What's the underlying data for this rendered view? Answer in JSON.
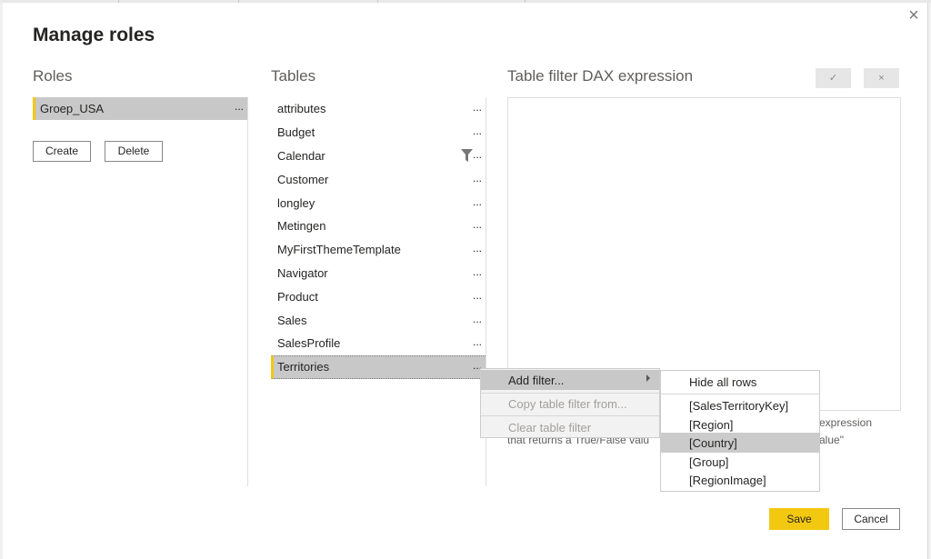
{
  "dialog": {
    "title": "Manage roles",
    "close_glyph": "×"
  },
  "roles": {
    "header": "Roles",
    "items": [
      {
        "label": "Groep_USA",
        "more": "..."
      }
    ],
    "create_label": "Create",
    "delete_label": "Delete"
  },
  "tables": {
    "header": "Tables",
    "items": [
      {
        "label": "attributes",
        "more": "..."
      },
      {
        "label": "Budget",
        "more": "..."
      },
      {
        "label": "Calendar",
        "more": "...",
        "icon": "filter-icon"
      },
      {
        "label": "Customer",
        "more": "..."
      },
      {
        "label": "longley",
        "more": "..."
      },
      {
        "label": "Metingen",
        "more": "..."
      },
      {
        "label": "MyFirstThemeTemplate",
        "more": "..."
      },
      {
        "label": "Navigator",
        "more": "..."
      },
      {
        "label": "Product",
        "more": "..."
      },
      {
        "label": "Sales",
        "more": "..."
      },
      {
        "label": "SalesProfile",
        "more": "..."
      },
      {
        "label": "Territories",
        "more": "...",
        "selected": true
      }
    ]
  },
  "dax": {
    "header": "Table filter DAX expression",
    "check_glyph": "✓",
    "cancel_glyph": "×",
    "help_line1_visible": "expression",
    "help_line2_left": "that returns a True/False valu",
    "help_line2_right": "alue\""
  },
  "context_menu": {
    "items": [
      {
        "label": "Add filter...",
        "highlighted": true,
        "has_submenu": true
      },
      {
        "label": "Copy table filter from...",
        "disabled": true
      },
      {
        "label": "Clear table filter",
        "disabled": true
      }
    ]
  },
  "submenu": {
    "items": [
      {
        "label": "Hide all rows"
      },
      {
        "label": "[SalesTerritoryKey]"
      },
      {
        "label": "[Region]"
      },
      {
        "label": "[Country]",
        "highlighted": true
      },
      {
        "label": "[Group]"
      },
      {
        "label": "[RegionImage]"
      }
    ]
  },
  "footer": {
    "save_label": "Save",
    "cancel_label": "Cancel"
  },
  "colors": {
    "accent": "#f2c811",
    "selection": "#c8c8c8"
  }
}
